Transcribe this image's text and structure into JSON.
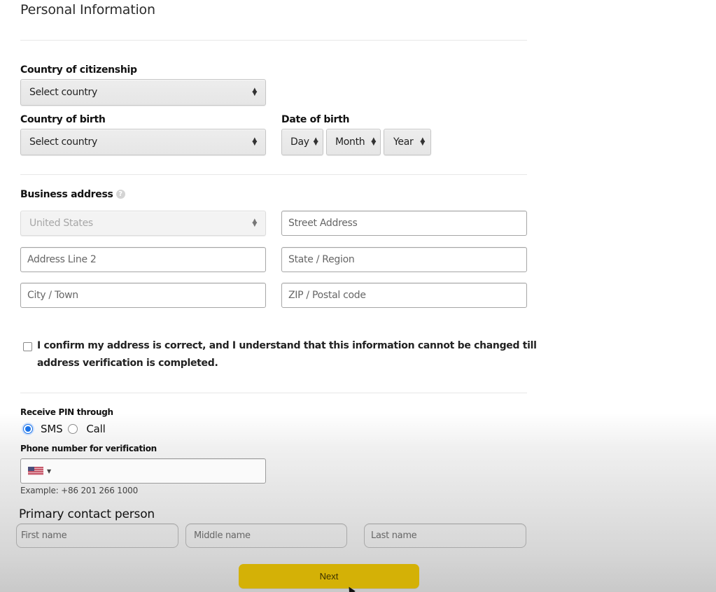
{
  "page": {
    "title": "Personal Information"
  },
  "citizenship": {
    "label": "Country of citizenship",
    "value": "Select country"
  },
  "birth_country": {
    "label": "Country of birth",
    "value": "Select country"
  },
  "dob": {
    "label": "Date of birth",
    "day": "Day",
    "month": "Month",
    "year": "Year"
  },
  "address": {
    "label": "Business address",
    "help_icon": "help-icon",
    "country_value": "United States",
    "street_placeholder": "Street Address",
    "line2_placeholder": "Address Line 2",
    "state_placeholder": "State / Region",
    "city_placeholder": "City / Town",
    "zip_placeholder": "ZIP / Postal code"
  },
  "confirm": {
    "checked": false,
    "line1": "I confirm my address is correct, and I understand that this information cannot be changed till",
    "line2": "address verification is completed."
  },
  "pin": {
    "label": "Receive PIN through",
    "options": [
      {
        "label": "SMS",
        "checked": true
      },
      {
        "label": "Call",
        "checked": false
      }
    ]
  },
  "phone": {
    "label": "Phone number for verification",
    "country_flag": "us-flag",
    "value": "",
    "example": "Example: +86 201 266 1000"
  },
  "contact": {
    "heading": "Primary contact person",
    "first_placeholder": "First name",
    "middle_placeholder": "Middle name",
    "last_placeholder": "Last name"
  },
  "actions": {
    "next_label": "Next",
    "next_color": "#d4b106"
  },
  "colors": {
    "radio_accent": "#1a73e8"
  }
}
